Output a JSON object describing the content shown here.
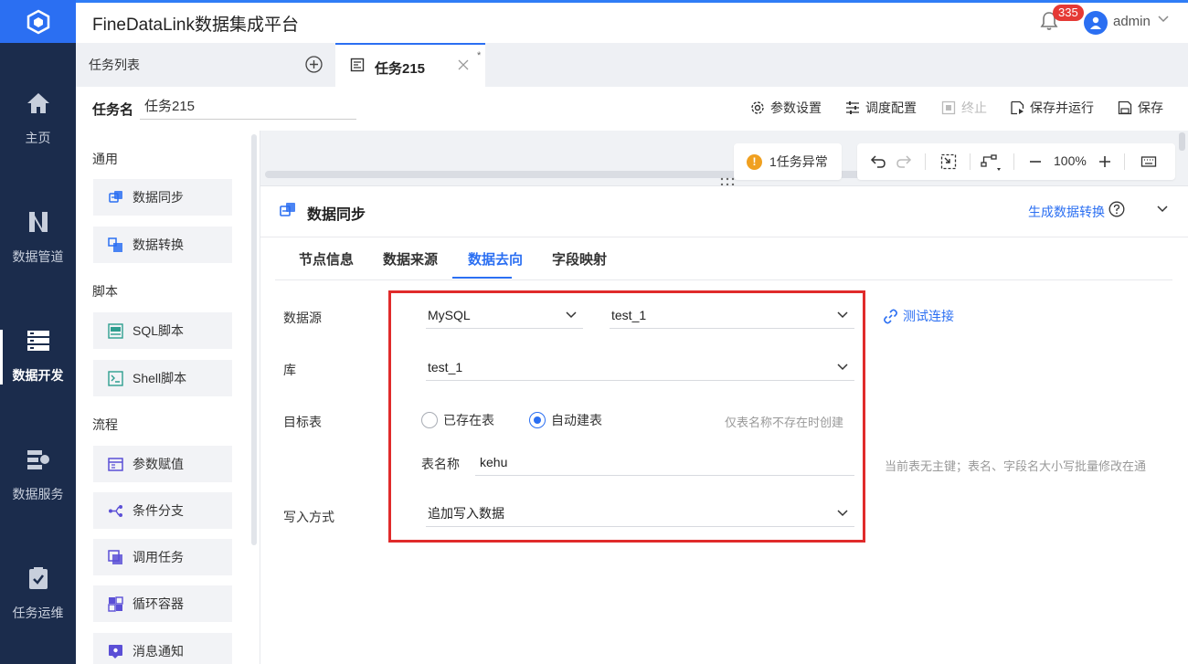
{
  "colors": {
    "nav_bg": "#1b2c4c",
    "brand": "#2b6ff2",
    "highlight": "#e02b2b",
    "warning": "#f0a020"
  },
  "app": {
    "title": "FineDataLink数据集成平台"
  },
  "header": {
    "notification_count": "335",
    "user": "admin"
  },
  "nav": [
    {
      "label": "主页",
      "icon": "home-icon"
    },
    {
      "label": "数据管道",
      "icon": "pipeline-icon"
    },
    {
      "label": "数据开发",
      "icon": "dev-icon",
      "active": true
    },
    {
      "label": "数据服务",
      "icon": "service-icon"
    },
    {
      "label": "任务运维",
      "icon": "ops-icon"
    }
  ],
  "tabs": {
    "list_label": "任务列表",
    "active_label": "任务215",
    "unsaved_mark": "*"
  },
  "task": {
    "name_label": "任务名",
    "name_value": "任务215",
    "buttons": [
      "参数设置",
      "调度配置",
      "终止",
      "保存并运行",
      "保存"
    ]
  },
  "components": {
    "sections": [
      {
        "title": "通用",
        "items": [
          "数据同步",
          "数据转换"
        ]
      },
      {
        "title": "脚本",
        "items": [
          "SQL脚本",
          "Shell脚本"
        ]
      },
      {
        "title": "流程",
        "items": [
          "参数赋值",
          "条件分支",
          "调用任务",
          "循环容器",
          "消息通知"
        ]
      }
    ]
  },
  "canvas": {
    "warning": "1任务异常",
    "zoom": "100%"
  },
  "panel": {
    "title": "数据同步",
    "gen_link": "生成数据转换",
    "tabs": [
      "节点信息",
      "数据来源",
      "数据去向",
      "字段映射"
    ],
    "active_tab": "数据去向",
    "form": {
      "datasource_label": "数据源",
      "datasource_type": "MySQL",
      "datasource_conn": "test_1",
      "test_link": "测试连接",
      "db_label": "库",
      "db_value": "test_1",
      "target_label": "目标表",
      "radio_existing": "已存在表",
      "radio_auto": "自动建表",
      "radio_selected": "自动建表",
      "auto_hint": "仅表名称不存在时创建",
      "table_name_label": "表名称",
      "table_name_value": "kehu",
      "table_hint": "当前表无主键；表名、字段名大小写批量修改在通",
      "write_label": "写入方式",
      "write_value": "追加写入数据"
    }
  }
}
